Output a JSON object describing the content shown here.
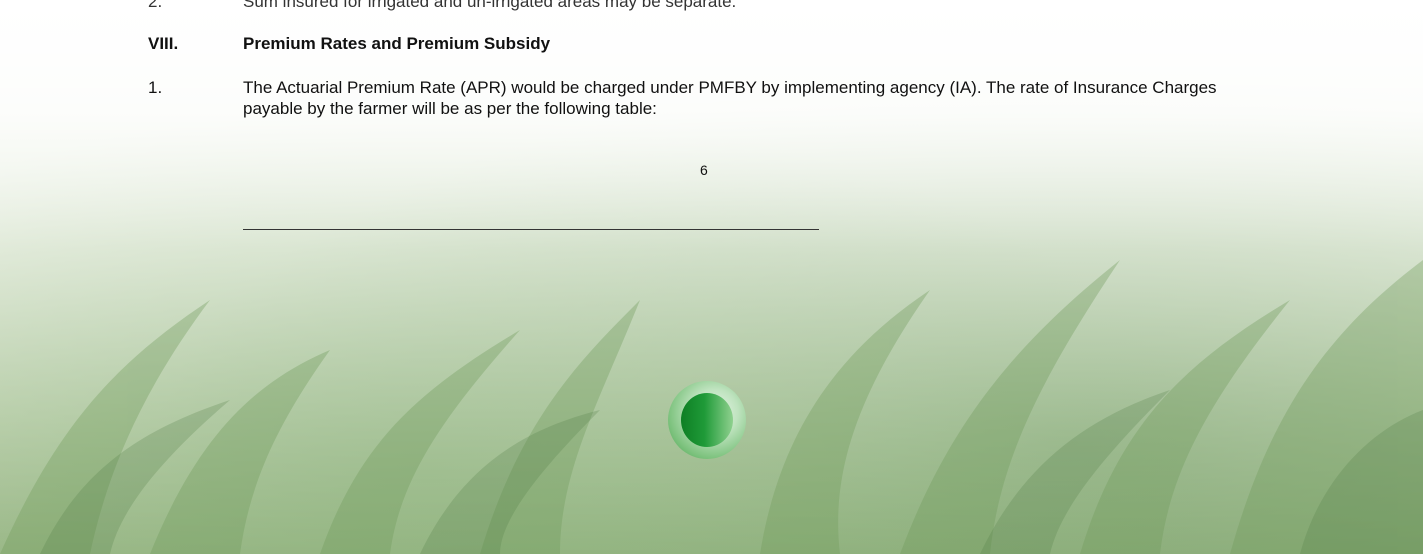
{
  "document": {
    "prev_item_number": "2.",
    "prev_item_text": "Sum insured for irrigated and un-irrigated areas may be separate.",
    "section_number": "VIII.",
    "section_title": "Premium Rates and Premium Subsidy",
    "item_1_number": "1.",
    "item_1_text": "The Actuarial Premium Rate (APR) would be charged under PMFBY by implementing agency (IA). The rate of Insurance Charges payable by the farmer will be as per the following table:",
    "page_number": "6"
  },
  "colors": {
    "logo_green": "#1f9a38",
    "text": "#111111"
  }
}
